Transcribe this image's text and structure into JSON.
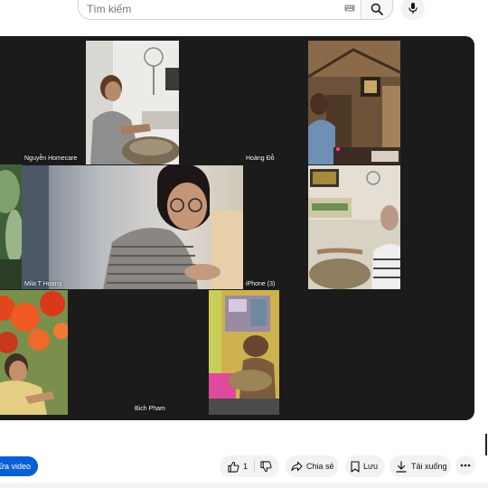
{
  "search": {
    "placeholder": "Tìm kiếm"
  },
  "video": {
    "participants": [
      {
        "name": "Nguyễn Homecare"
      },
      {
        "name": "Hoàng Đỗ"
      },
      {
        "name": "Mila T Hoang"
      },
      {
        "name": "iPhone (3)"
      },
      {
        "name": "Bich Pham"
      }
    ]
  },
  "actions": {
    "edit_video": "sửa video",
    "like_count": "1",
    "share": "Chia sẻ",
    "save": "Lưu",
    "download": "Tải xuống"
  },
  "colors": {
    "accent": "#065fd4",
    "player_bg": "#1b1b1b",
    "button_bg": "#f2f2f2"
  },
  "icons": [
    "keyboard-icon",
    "search-icon",
    "mic-icon",
    "thumbs-up-icon",
    "thumbs-down-icon",
    "share-icon",
    "bookmark-icon",
    "download-icon",
    "more-icon"
  ]
}
